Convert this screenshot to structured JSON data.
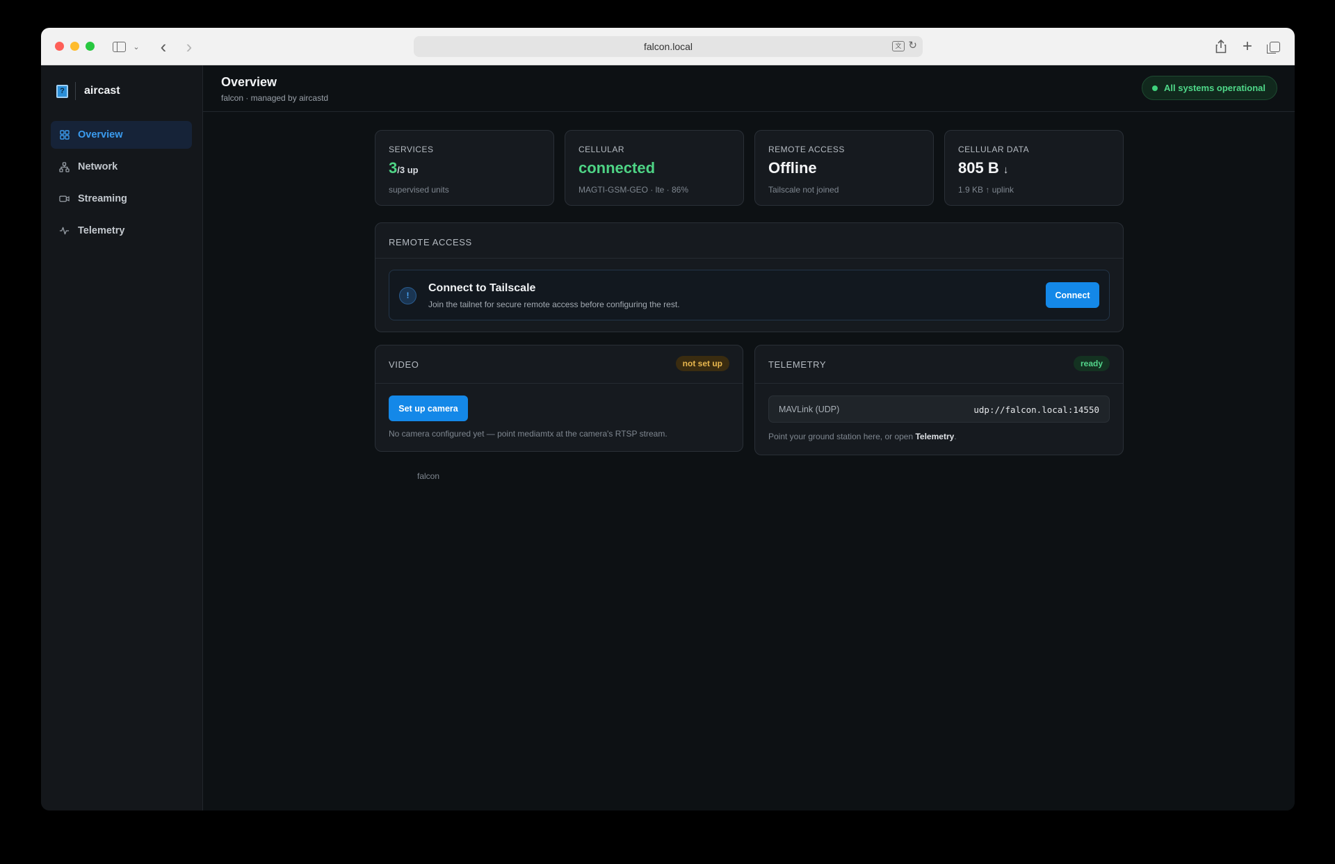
{
  "browser": {
    "url": "falcon.local"
  },
  "sidebar": {
    "brand": "aircast",
    "logo_glyph": "?",
    "items": [
      {
        "label": "Overview",
        "icon": "grid-icon",
        "active": true
      },
      {
        "label": "Network",
        "icon": "network-icon",
        "active": false
      },
      {
        "label": "Streaming",
        "icon": "camera-icon",
        "active": false
      },
      {
        "label": "Telemetry",
        "icon": "pulse-icon",
        "active": false
      }
    ]
  },
  "header": {
    "title": "Overview",
    "subtitle": "falcon · managed by aircastd",
    "status": "All systems operational"
  },
  "stats": {
    "services": {
      "label": "SERVICES",
      "value": "3",
      "suffix": "/3 up",
      "sub": "supervised units"
    },
    "cellular": {
      "label": "CELLULAR",
      "value": "connected",
      "sub": "MAGTI-GSM-GEO · lte · 86%"
    },
    "remote": {
      "label": "REMOTE ACCESS",
      "value": "Offline",
      "sub": "Tailscale not joined"
    },
    "data": {
      "label": "CELLULAR DATA",
      "value": "805 B",
      "arrow": "↓",
      "sub": "1.9 KB ↑ uplink"
    }
  },
  "remote_access": {
    "heading": "REMOTE ACCESS",
    "icon_glyph": "!",
    "title": "Connect to Tailscale",
    "description": "Join the tailnet for secure remote access before configuring the rest.",
    "button": "Connect"
  },
  "video": {
    "heading": "VIDEO",
    "badge": "not set up",
    "button": "Set up camera",
    "note": "No camera configured yet — point mediamtx at the camera's RTSP stream."
  },
  "telemetry": {
    "heading": "TELEMETRY",
    "badge": "ready",
    "row_label": "MAVLink (UDP)",
    "row_value": "udp://falcon.local:14550",
    "note_prefix": "Point your ground station here, or open",
    "note_link": "Telemetry",
    "note_suffix": "."
  },
  "footer": "falcon",
  "colors": {
    "accent": "#1488e8",
    "success": "#4ed485",
    "warning": "#e9b84f",
    "background": "#0d1114"
  }
}
